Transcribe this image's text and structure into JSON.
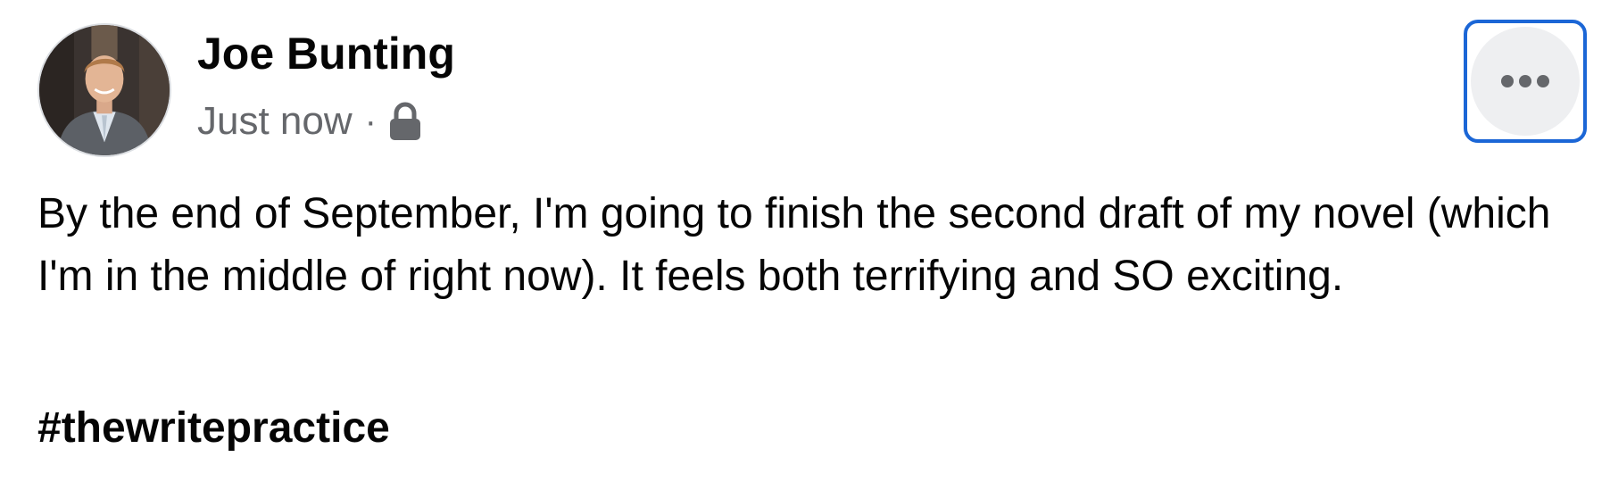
{
  "post": {
    "author_name": "Joe Bunting",
    "timestamp": "Just now",
    "separator": "·",
    "privacy_icon": "lock-icon",
    "more_icon": "more-options-icon",
    "body_text": "By the end of September, I'm going to finish the second draft of my novel (which I'm in the middle of right now). It feels both terrifying and SO exciting.",
    "hashtag": "#thewritepractice"
  },
  "colors": {
    "text_primary": "#050505",
    "text_secondary": "#65676b",
    "focus_ring": "#1b66d6",
    "button_bg": "#eeeff1"
  }
}
